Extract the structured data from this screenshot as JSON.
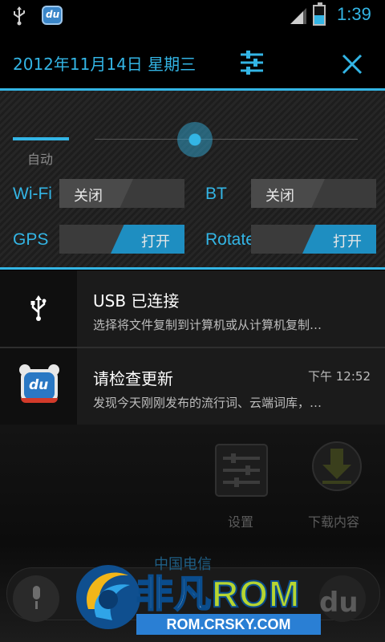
{
  "status_bar": {
    "time": "1:39"
  },
  "header": {
    "date": "2012年11月14日 星期三"
  },
  "quick_panel": {
    "brightness_auto_label": "自动",
    "brightness_level": 0.38,
    "toggles": [
      {
        "label": "Wi-Fi",
        "state_text": "关闭",
        "on": false
      },
      {
        "label": "BT",
        "state_text": "关闭",
        "on": false
      },
      {
        "label": "GPS",
        "state_text": "打开",
        "on": true
      },
      {
        "label": "Rotate",
        "state_text": "打开",
        "on": true
      }
    ]
  },
  "notifications": [
    {
      "title": "USB 已连接",
      "description": "选择将文件复制到计算机或从计算机复制…",
      "time": ""
    },
    {
      "title": "请检查更新",
      "description": "发现今天刚刚发布的流行词、云端词库，…",
      "time": "下午 12:52"
    }
  ],
  "home": {
    "icons": [
      {
        "label": "设置"
      },
      {
        "label": "下载内容"
      }
    ],
    "carrier": "中国电信"
  },
  "watermark": {
    "brand_left": "非凡",
    "brand_right": "ROM",
    "url": "ROM.CRSKY.COM",
    "du": "du"
  },
  "colors": {
    "accent": "#33b5e5",
    "toggle_on": "#1e8ec1"
  }
}
